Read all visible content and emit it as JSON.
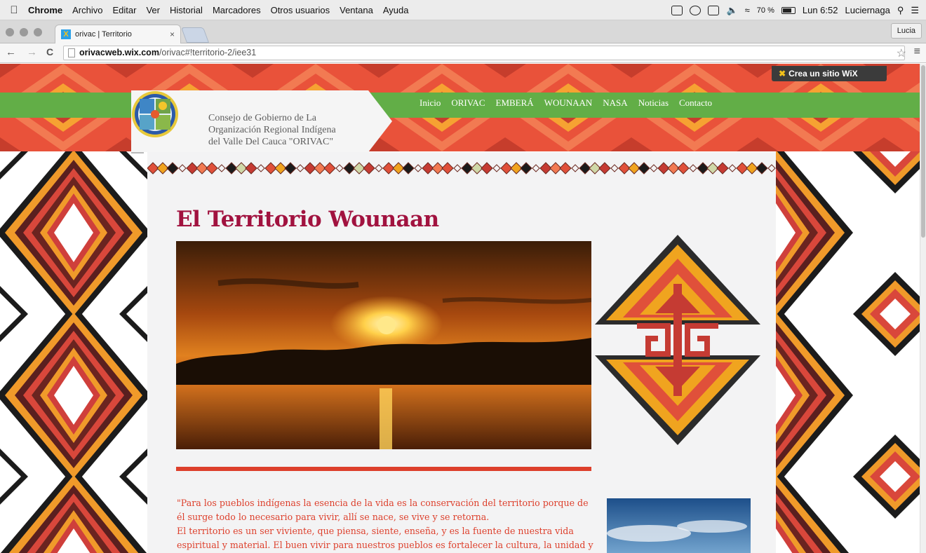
{
  "menubar": {
    "apple": "",
    "items": [
      "Chrome",
      "Archivo",
      "Editar",
      "Ver",
      "Historial",
      "Marcadores",
      "Otros usuarios",
      "Ventana",
      "Ayuda"
    ],
    "battery": "70 %",
    "clock": "Lun 6:52",
    "user": "Luciernaga",
    "search_icon": "magnifier-icon",
    "list_icon": "list-icon"
  },
  "browser": {
    "tab_title": "orivac | Territorio",
    "tab_close": "×",
    "profile": "Lucia",
    "url_host": "orivacweb.wix.com",
    "url_path": "/orivac#!territorio-2/iee31",
    "back": "←",
    "forward": "→",
    "reload": "C",
    "star": "☆",
    "menu": "≡"
  },
  "wix_banner": {
    "prefix": "Crea un sitio",
    "brand": "WiX"
  },
  "header": {
    "org_lines": [
      "Consejo de Gobierno de La",
      "Organización Regional Indígena",
      "del Valle Del Cauca \"ORIVAC\""
    ],
    "nav": [
      "Inicio",
      "ORIVAC",
      "EMBERÁ",
      "WOUNAAN",
      "NASA",
      "Noticias",
      "Contacto"
    ]
  },
  "content": {
    "title": "El Territorio Wounaan",
    "quote_p1": "\"Para los pueblos indígenas la esencia de la vida es la conservación del territorio porque de él surge todo lo necesario para vivir, allí se nace, se vive y se retorna.",
    "quote_p2": "El territorio es un ser viviente, que piensa, siente, enseña, y es la fuente de nuestra vida espiritual y material. El buen vivir para nuestros pueblos es fortalecer la cultura, la unidad y"
  },
  "colors": {
    "green": "#62ae47",
    "maroon": "#a1123f",
    "orange_red": "#dd3f2b",
    "pattern_red": "#e0503a",
    "pattern_orange": "#f09a2a"
  }
}
